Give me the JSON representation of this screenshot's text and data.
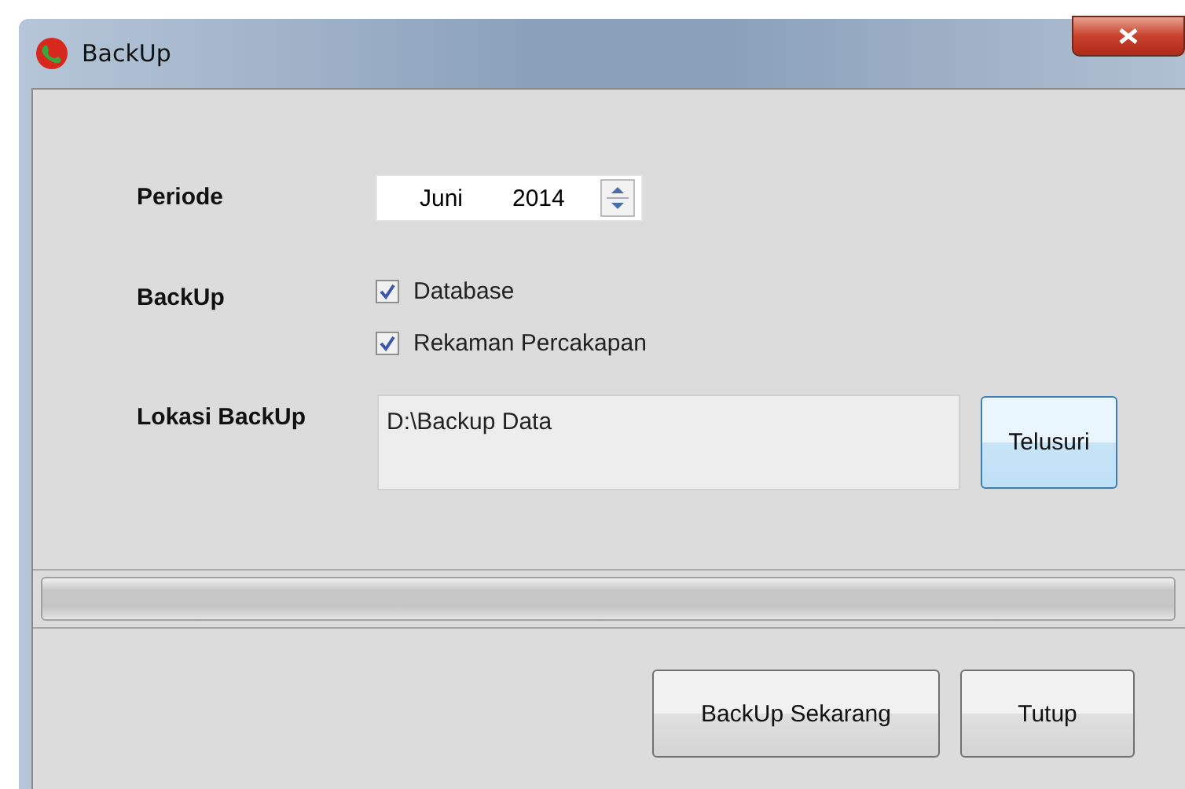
{
  "window": {
    "title": "BackUp"
  },
  "periode": {
    "label": "Periode",
    "month": "Juni",
    "year": "2014"
  },
  "backup": {
    "label": "BackUp",
    "options": [
      {
        "label": "Database",
        "checked": true
      },
      {
        "label": "Rekaman Percakapan",
        "checked": true
      }
    ]
  },
  "lokasi": {
    "label": "Lokasi BackUp",
    "value": "D:\\Backup Data",
    "browse_button": "Telusuri"
  },
  "progress": {
    "level": 0
  },
  "buttons": [
    "BackUp Sekarang",
    "Tutup"
  ]
}
